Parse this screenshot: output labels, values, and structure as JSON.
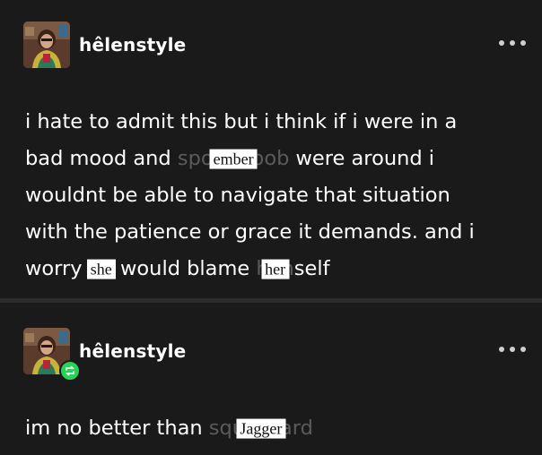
{
  "posts": [
    {
      "username_prefix": "hêlen",
      "username_suffix": "style",
      "lines": [
        {
          "segments": [
            "i hate to admit this but i think if i were in a"
          ]
        },
        {
          "pre": "bad mood and ",
          "faded": "spongebob",
          "sticker": "ember",
          "post": " were around i"
        },
        {
          "segments": [
            "wouldnt be able to navigate that situation"
          ]
        },
        {
          "segments": [
            "with the patience or grace it demands. and i"
          ]
        }
      ],
      "last_line": {
        "w1": "worry ",
        "faded1": "he",
        "sticker1": "she",
        "mid": " would blame ",
        "faded2": "him",
        "sticker2": "her",
        "end": "self"
      }
    },
    {
      "username_prefix": "hêlen",
      "username_suffix": "style",
      "text_pre": "im no better than ",
      "faded": "squidward",
      "sticker": "Jagger"
    }
  ],
  "icons": {
    "more": "more-options-icon",
    "badge": "reblog-badge-icon"
  },
  "colors": {
    "background": "#1a1a1a",
    "text": "#ffffff",
    "faded_text": "#5b5b5b",
    "badge": "#2ad05a"
  }
}
